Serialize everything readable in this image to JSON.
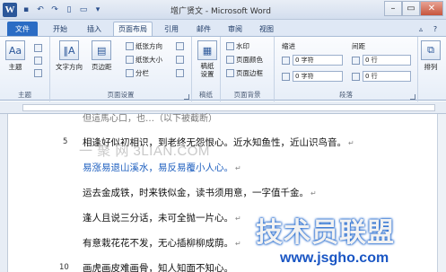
{
  "window": {
    "title": "增广贤文 - Microsoft Word"
  },
  "tabs": [
    "文件",
    "开始",
    "插入",
    "页面布局",
    "引用",
    "邮件",
    "审阅",
    "视图"
  ],
  "ribbon": {
    "theme": {
      "label": "主题",
      "group": "主题"
    },
    "page_setup": {
      "group": "页面设置",
      "text_direction": "文字方向",
      "margins": "页边距",
      "orientation": "纸张方向",
      "size": "纸张大小",
      "columns": "分栏"
    },
    "paper": {
      "group": "稿纸",
      "label": "稿纸\n设置"
    },
    "background": {
      "group": "页面背景",
      "watermark": "水印",
      "page_color": "页面颜色",
      "page_border": "页面边框"
    },
    "paragraph": {
      "group": "段落",
      "indent": "缩进",
      "spacing": "间距",
      "left": "0 字符",
      "right": "0 字符",
      "before": "0 行",
      "after": "0 行"
    },
    "arrange": {
      "label": "排列"
    }
  },
  "document": {
    "lines": [
      {
        "num": "5",
        "text": "相逢好似初相识，到老终无怨恨心。近水知鱼性，近山识鸟音。"
      },
      {
        "num": "",
        "text": "易涨易退山溪水，易反易覆小人心。"
      },
      {
        "num": "",
        "text": "运去金成铁，时来铁似金，读书须用意，一字值千金。"
      },
      {
        "num": "",
        "text": "逢人且说三分话，未可全抛一片心。"
      },
      {
        "num": "",
        "text": "有意栽花花不发，无心插柳柳成荫。"
      },
      {
        "num": "10",
        "text": "画虎画皮难画骨，知人知面不知心。"
      }
    ],
    "partial_top": "但這馬心口，也…（以下被截断）"
  },
  "overlay": {
    "watermark_small": "一 聚 网 3LIAN.COM",
    "logo_text": "技术员联盟",
    "logo_url": "www.jsgho.com"
  }
}
